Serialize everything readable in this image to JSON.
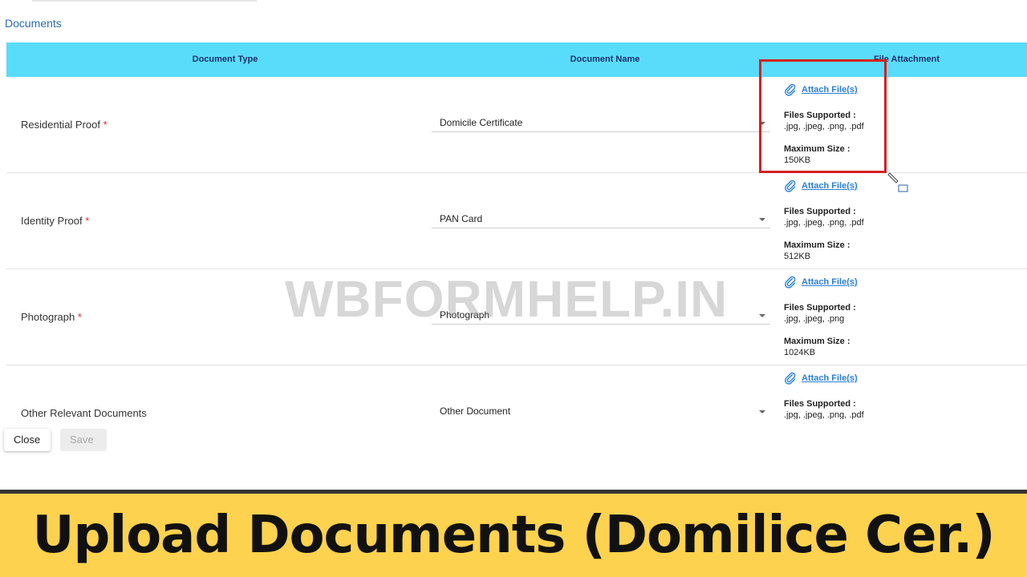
{
  "section_title": "Documents",
  "table": {
    "headers": {
      "type": "Document Type",
      "name": "Document Name",
      "file": "File Attachment"
    },
    "rows": [
      {
        "type": "Residential Proof",
        "required": "*",
        "document_name": "Domicile Certificate",
        "attach_label": "Attach File(s)",
        "files_supported_label": "Files Supported :",
        "files_supported": ".jpg, .jpeg, .png, .pdf",
        "max_size_label": "Maximum Size :",
        "max_size": "150KB"
      },
      {
        "type": "Identity Proof",
        "required": "*",
        "document_name": "PAN Card",
        "attach_label": "Attach File(s)",
        "files_supported_label": "Files Supported :",
        "files_supported": ".jpg, .jpeg, .png, .pdf",
        "max_size_label": "Maximum Size :",
        "max_size": "512KB"
      },
      {
        "type": "Photograph",
        "required": "*",
        "document_name": "Photograph",
        "attach_label": "Attach File(s)",
        "files_supported_label": "Files Supported :",
        "files_supported": ".jpg, .jpeg, .png",
        "max_size_label": "Maximum Size :",
        "max_size": "1024KB"
      },
      {
        "type": "Other Relevant Documents",
        "required": "",
        "document_name": "Other Document",
        "attach_label": "Attach File(s)",
        "files_supported_label": "Files Supported :",
        "files_supported": ".jpg, .jpeg, .png, .pdf",
        "max_size_label": "",
        "max_size": ""
      }
    ]
  },
  "buttons": {
    "close": "Close",
    "save": "Save"
  },
  "watermark": "WBFORMHELP.IN",
  "banner": "Upload Documents (Domilice Cer.)",
  "colors": {
    "header_bg": "#59dcfa",
    "link": "#2b7fd8",
    "highlight": "#d42020",
    "banner_bg": "#fdd24e"
  }
}
